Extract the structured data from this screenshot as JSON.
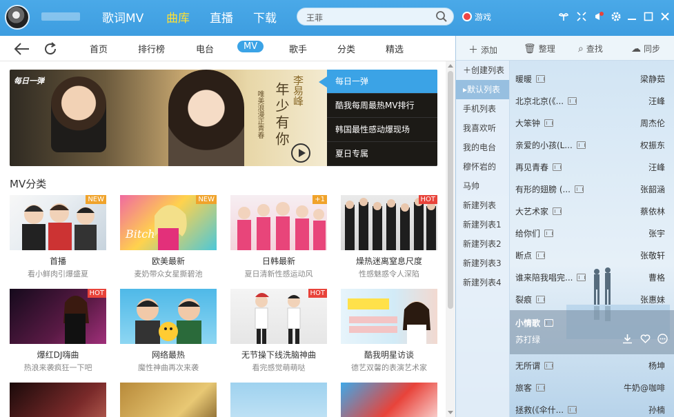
{
  "header": {
    "nav": [
      "歌词MV",
      "曲库",
      "直播",
      "下载"
    ],
    "active_nav": "曲库",
    "search": {
      "value": "王菲"
    },
    "game_label": "游戏"
  },
  "subnav": {
    "tabs": [
      "首页",
      "排行榜",
      "电台",
      "MV",
      "歌手",
      "分类",
      "精选"
    ],
    "active_tab": "MV"
  },
  "banner": {
    "logo": "每日一弹",
    "singer": "李易峰",
    "title": "年少有你",
    "subtitle": "唯美浪漫正青春",
    "items": [
      "每日一弹",
      "酷我每周最热MV排行",
      "韩国最性感动爆现场",
      "夏日专属"
    ]
  },
  "section_title": "MV分类",
  "cards": [
    {
      "title": "首播",
      "desc": "看小鲜肉引爆盛夏",
      "badge": "NEW",
      "badge_type": "new"
    },
    {
      "title": "欧美最新",
      "desc": "麦奶带众女星撕碧池",
      "badge": "NEW",
      "badge_type": "new"
    },
    {
      "title": "日韩最新",
      "desc": "夏日清新性感运动风",
      "badge": "+1",
      "badge_type": "new"
    },
    {
      "title": "燥热迷离窒息尺度",
      "desc": "性感魅惑令人深陷",
      "badge": "HOT",
      "badge_type": "hot"
    },
    {
      "title": "爆红DJ嗨曲",
      "desc": "热浪来袭疯狂一下吧",
      "badge": "HOT",
      "badge_type": "hot"
    },
    {
      "title": "网络最热",
      "desc": "魔性神曲再次来袭",
      "badge": "",
      "badge_type": ""
    },
    {
      "title": "无节操下线洗脑神曲",
      "desc": "看完感觉萌萌哒",
      "badge": "HOT",
      "badge_type": "hot"
    },
    {
      "title": "酷我明星访谈",
      "desc": "德艺双馨的表演艺术家",
      "badge": "",
      "badge_type": ""
    }
  ],
  "right_panel": {
    "toolbar": [
      "添加",
      "整理",
      "查找",
      "同步"
    ],
    "playlists": [
      "创建列表",
      "默认列表",
      "手机列表",
      "我喜欢听",
      "我的电台",
      "穆怀岩的",
      "马帅",
      "新建列表",
      "新建列表1",
      "新建列表2",
      "新建列表3",
      "新建列表4"
    ],
    "active_playlist": "默认列表",
    "songs": [
      {
        "name": "暖暖",
        "artist": "梁静茹"
      },
      {
        "name": "北京北京(《...",
        "artist": "汪峰"
      },
      {
        "name": "大笨钟",
        "artist": "周杰伦"
      },
      {
        "name": "亲爱的小孩(L...",
        "artist": "权振东"
      },
      {
        "name": "再见青春",
        "artist": "汪峰"
      },
      {
        "name": "有形的翅膀 (...",
        "artist": "张韶涵"
      },
      {
        "name": "大艺术家",
        "artist": "蔡依林"
      },
      {
        "name": "给你们",
        "artist": "张宇"
      },
      {
        "name": "断点",
        "artist": "张敬轩"
      },
      {
        "name": "谁来陪我唱完...",
        "artist": "曹格"
      },
      {
        "name": "裂痕",
        "artist": "张惠妹"
      }
    ],
    "current": {
      "name": "小情歌",
      "artist": "苏打绿"
    },
    "songs_after": [
      {
        "name": "无所谓",
        "artist": "杨坤"
      },
      {
        "name": "旅客",
        "artist": "牛奶@咖啡"
      },
      {
        "name": "拯救(《伞什...",
        "artist": "孙楠"
      }
    ]
  },
  "colors": {
    "header_blue": "#3d9de0",
    "active_nav": "#ffe033",
    "accent": "#3ba3e6",
    "hot": "#e8433a",
    "new": "#f0a32b"
  }
}
